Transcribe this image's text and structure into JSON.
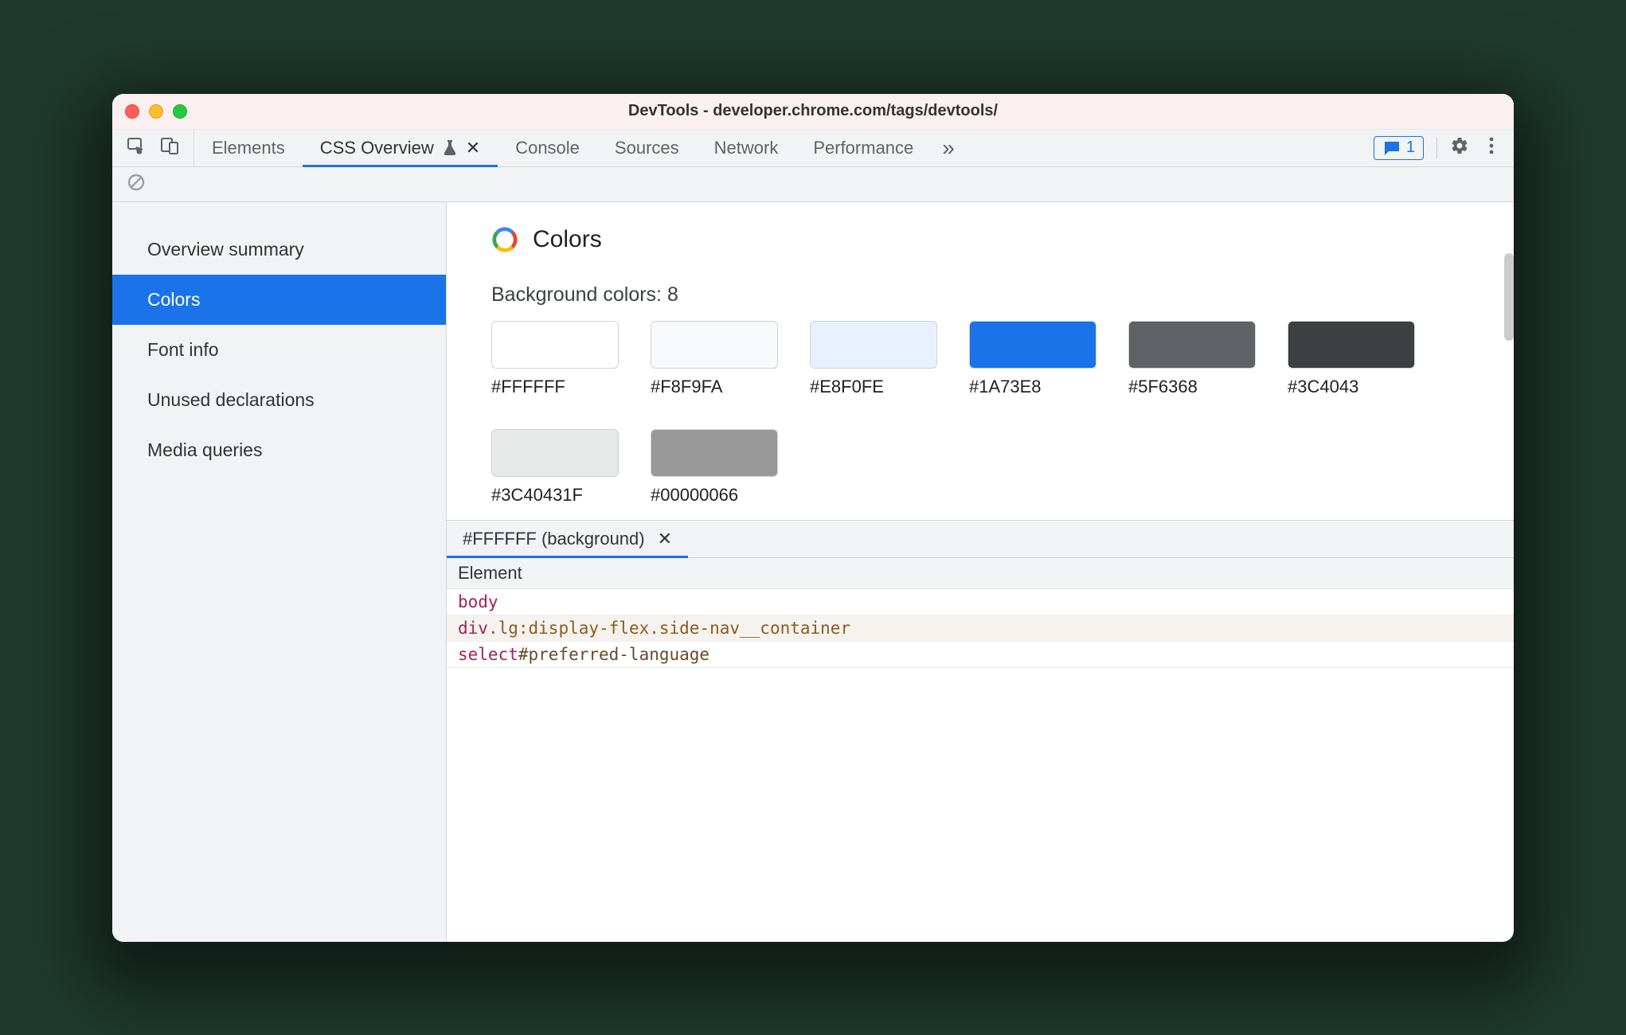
{
  "window_title": "DevTools - developer.chrome.com/tags/devtools/",
  "tabs": {
    "items": [
      "Elements",
      "CSS Overview",
      "Console",
      "Sources",
      "Network",
      "Performance"
    ],
    "active_index": 1,
    "more_glyph": "»",
    "messages_count": "1"
  },
  "sidebar": {
    "items": [
      "Overview summary",
      "Colors",
      "Font info",
      "Unused declarations",
      "Media queries"
    ],
    "active_index": 1
  },
  "colors": {
    "title": "Colors",
    "section_label": "Background colors: 8",
    "swatches": [
      {
        "hex": "#FFFFFF",
        "display": "#FFFFFF"
      },
      {
        "hex": "#F8F9FA",
        "display": "#F8F9FA"
      },
      {
        "hex": "#E8F0FE",
        "display": "#E8F0FE"
      },
      {
        "hex": "#1A73E8",
        "display": "#1A73E8"
      },
      {
        "hex": "#5F6368",
        "display": "#5F6368"
      },
      {
        "hex": "#3C4043",
        "display": "#3C4043"
      },
      {
        "hex": "rgba(60,64,67,0.12)",
        "display": "#3C40431F"
      },
      {
        "hex": "rgba(0,0,0,0.40)",
        "display": "#00000066"
      }
    ]
  },
  "detail": {
    "tab_label": "#FFFFFF (background)",
    "header": "Element",
    "rows": [
      {
        "parts": [
          {
            "t": "tag",
            "v": "body"
          }
        ]
      },
      {
        "parts": [
          {
            "t": "tag",
            "v": "div"
          },
          {
            "t": "cls",
            "v": ".lg:display-flex"
          },
          {
            "t": "cls",
            "v": ".side-nav__container"
          }
        ]
      },
      {
        "parts": [
          {
            "t": "tag",
            "v": "select"
          },
          {
            "t": "id",
            "v": "#preferred-language"
          }
        ]
      }
    ]
  },
  "close_glyph": "✕"
}
